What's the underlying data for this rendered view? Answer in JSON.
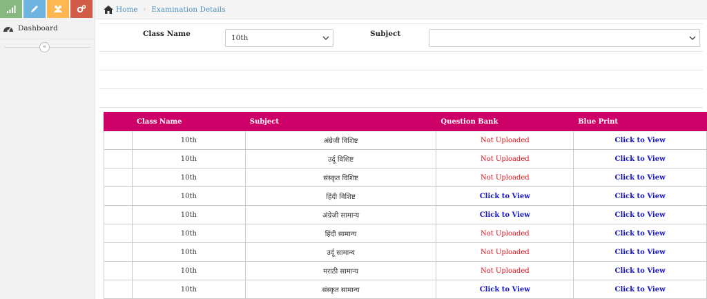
{
  "sidebar": {
    "shortcuts": [
      {
        "icon": "signal-icon",
        "color": "#87b87f"
      },
      {
        "icon": "pencil-icon",
        "color": "#6fb3e0"
      },
      {
        "icon": "users-icon",
        "color": "#ffb752"
      },
      {
        "icon": "cogs-icon",
        "color": "#d15b47"
      }
    ],
    "dashboard_label": "Dashboard",
    "collapse_glyph": "«"
  },
  "breadcrumb": {
    "home": "Home",
    "current": "Examination Details"
  },
  "filters": {
    "class_label": "Class Name",
    "class_value": "10th",
    "subject_label": "Subject",
    "subject_value": ""
  },
  "table": {
    "headers": [
      "",
      "Class Name",
      "Subject",
      "Question Bank",
      "Blue Print"
    ],
    "rows": [
      {
        "class": "10th",
        "subject": "अंग्रेजी विशिष्ट",
        "qb": "Not Uploaded",
        "qb_status": "not-uploaded",
        "bp": "Click to View",
        "bp_status": "link"
      },
      {
        "class": "10th",
        "subject": "उर्दू विशिष्ट",
        "qb": "Not Uploaded",
        "qb_status": "not-uploaded",
        "bp": "Click to View",
        "bp_status": "link"
      },
      {
        "class": "10th",
        "subject": "संस्कृत विशिष्ट",
        "qb": "Not Uploaded",
        "qb_status": "not-uploaded",
        "bp": "Click to View",
        "bp_status": "link"
      },
      {
        "class": "10th",
        "subject": "हिंदी विशिष्ट",
        "qb": "Click to View",
        "qb_status": "link",
        "bp": "Click to View",
        "bp_status": "link"
      },
      {
        "class": "10th",
        "subject": "अंग्रेजी सामान्य",
        "qb": "Click to View",
        "qb_status": "link",
        "bp": "Click to View",
        "bp_status": "link"
      },
      {
        "class": "10th",
        "subject": "हिंदी सामान्य",
        "qb": "Not Uploaded",
        "qb_status": "not-uploaded",
        "bp": "Click to View",
        "bp_status": "link"
      },
      {
        "class": "10th",
        "subject": "उर्दू सामान्य",
        "qb": "Not Uploaded",
        "qb_status": "not-uploaded",
        "bp": "Click to View",
        "bp_status": "link"
      },
      {
        "class": "10th",
        "subject": "मराठी सामान्य",
        "qb": "Not Uploaded",
        "qb_status": "not-uploaded",
        "bp": "Click to View",
        "bp_status": "link"
      },
      {
        "class": "10th",
        "subject": "संस्कृत सामान्य",
        "qb": "Click to View",
        "qb_status": "link",
        "bp": "Click to View",
        "bp_status": "link"
      }
    ]
  },
  "colors": {
    "header_bg": "#cc0066",
    "not_uploaded": "#e0101a",
    "link": "#1515c8",
    "breadcrumb_link": "#4c8fbd"
  }
}
